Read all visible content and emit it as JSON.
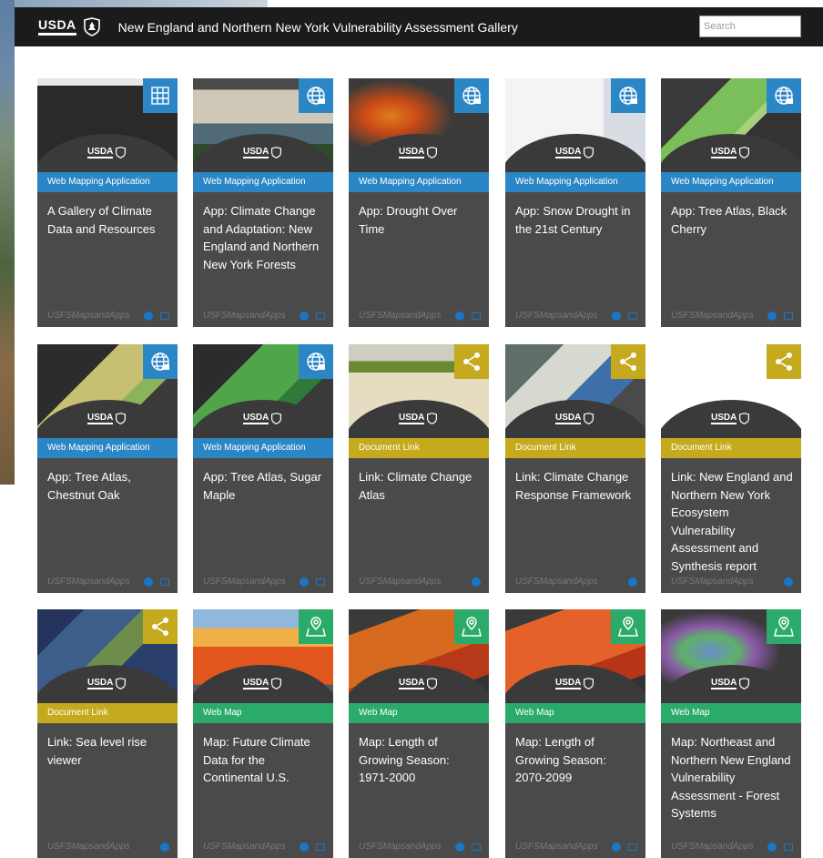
{
  "header": {
    "logo_text": "USDA",
    "title": "New England and Northern New York Vulnerability Assessment Gallery",
    "search_placeholder": "Search"
  },
  "colors": {
    "web_mapping_application": "#2b86c5",
    "document_link": "#c6aa1e",
    "web_map": "#2bab6a",
    "card_bg": "#4a4a4a",
    "topbar": "#1b1b1b"
  },
  "cards": [
    {
      "type": "Web Mapping Application",
      "title": "A Gallery of Climate Data and Resources",
      "owner": "USFSMapsandApps",
      "icon": "grid-icon"
    },
    {
      "type": "Web Mapping Application",
      "title": "App: Climate Change and Adaptation: New England and Northern New York Forests",
      "owner": "USFSMapsandApps",
      "icon": "globe-icon"
    },
    {
      "type": "Web Mapping Application",
      "title": "App: Drought Over Time",
      "owner": "USFSMapsandApps",
      "icon": "globe-icon"
    },
    {
      "type": "Web Mapping Application",
      "title": "App: Snow Drought in the 21st Century",
      "owner": "USFSMapsandApps",
      "icon": "globe-icon"
    },
    {
      "type": "Web Mapping Application",
      "title": "App: Tree Atlas, Black Cherry",
      "owner": "USFSMapsandApps",
      "icon": "globe-icon"
    },
    {
      "type": "Web Mapping Application",
      "title": "App: Tree Atlas, Chestnut Oak",
      "owner": "USFSMapsandApps",
      "icon": "globe-icon"
    },
    {
      "type": "Web Mapping Application",
      "title": "App: Tree Atlas, Sugar Maple",
      "owner": "USFSMapsandApps",
      "icon": "globe-icon"
    },
    {
      "type": "Document Link",
      "title": "Link: Climate Change Atlas",
      "owner": "USFSMapsandApps",
      "icon": "share-icon"
    },
    {
      "type": "Document Link",
      "title": "Link: Climate Change Response Framework",
      "owner": "USFSMapsandApps",
      "icon": "share-icon"
    },
    {
      "type": "Document Link",
      "title": "Link: New England and Northern New York Ecosystem Vulnerability Assessment and Synthesis report",
      "owner": "USFSMapsandApps",
      "icon": "share-icon"
    },
    {
      "type": "Document Link",
      "title": "Link: Sea level rise viewer",
      "owner": "USFSMapsandApps",
      "icon": "share-icon"
    },
    {
      "type": "Web Map",
      "title": "Map: Future Climate Data for the Continental U.S.",
      "owner": "USFSMapsandApps",
      "icon": "map-icon"
    },
    {
      "type": "Web Map",
      "title": "Map: Length of Growing Season: 1971-2000",
      "owner": "USFSMapsandApps",
      "icon": "map-icon"
    },
    {
      "type": "Web Map",
      "title": "Map: Length of Growing Season: 2070-2099",
      "owner": "USFSMapsandApps",
      "icon": "map-icon"
    },
    {
      "type": "Web Map",
      "title": "Map: Northeast and Northern New England Vulnerability Assessment - Forest Systems",
      "owner": "USFSMapsandApps",
      "icon": "map-icon"
    }
  ]
}
